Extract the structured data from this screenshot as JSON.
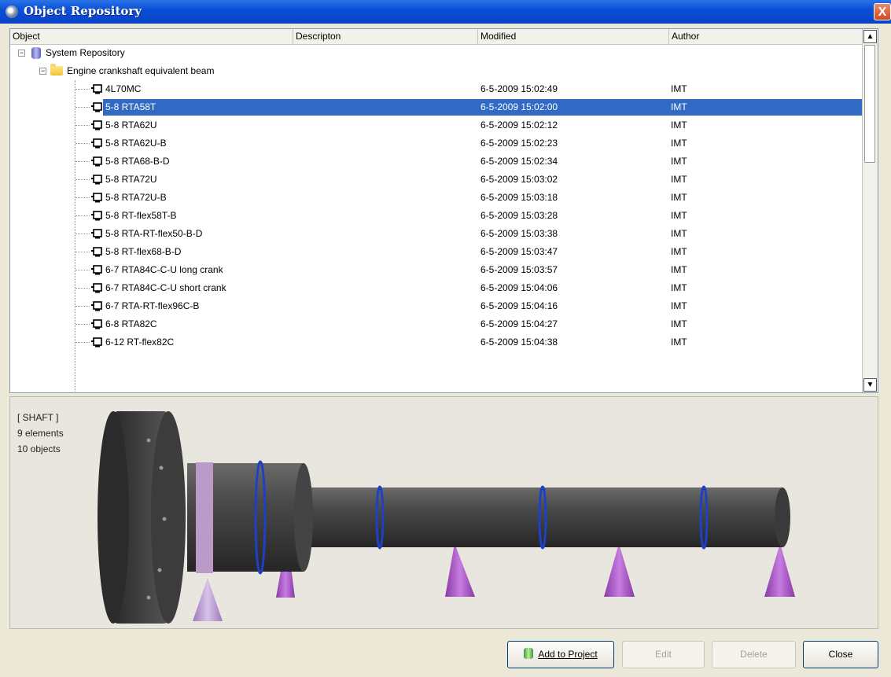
{
  "window": {
    "title": "Object Repository",
    "close_label": "X"
  },
  "columns": [
    "Object",
    "Descripton",
    "Modified",
    "Author"
  ],
  "tree": {
    "root": "System Repository",
    "folder": "Engine crankshaft equivalent beam",
    "items": [
      {
        "name": "4L70MC",
        "modified": "6-5-2009 15:02:49",
        "author": "IMT"
      },
      {
        "name": "5-8 RTA58T",
        "modified": "6-5-2009 15:02:00",
        "author": "IMT",
        "selected": true
      },
      {
        "name": "5-8 RTA62U",
        "modified": "6-5-2009 15:02:12",
        "author": "IMT"
      },
      {
        "name": "5-8 RTA62U-B",
        "modified": "6-5-2009 15:02:23",
        "author": "IMT"
      },
      {
        "name": "5-8 RTA68-B-D",
        "modified": "6-5-2009 15:02:34",
        "author": "IMT"
      },
      {
        "name": "5-8 RTA72U",
        "modified": "6-5-2009 15:03:02",
        "author": "IMT"
      },
      {
        "name": "5-8 RTA72U-B",
        "modified": "6-5-2009 15:03:18",
        "author": "IMT"
      },
      {
        "name": "5-8 RT-flex58T-B",
        "modified": "6-5-2009 15:03:28",
        "author": "IMT"
      },
      {
        "name": "5-8 RTA-RT-flex50-B-D",
        "modified": "6-5-2009 15:03:38",
        "author": "IMT"
      },
      {
        "name": "5-8 RT-flex68-B-D",
        "modified": "6-5-2009 15:03:47",
        "author": "IMT"
      },
      {
        "name": "6-7 RTA84C-C-U long crank",
        "modified": "6-5-2009 15:03:57",
        "author": "IMT"
      },
      {
        "name": "6-7 RTA84C-C-U short crank",
        "modified": "6-5-2009 15:04:06",
        "author": "IMT"
      },
      {
        "name": "6-7 RTA-RT-flex96C-B",
        "modified": "6-5-2009 15:04:16",
        "author": "IMT"
      },
      {
        "name": "6-8 RTA82C",
        "modified": "6-5-2009 15:04:27",
        "author": "IMT"
      },
      {
        "name": "6-12 RT-flex82C",
        "modified": "6-5-2009 15:04:38",
        "author": "IMT"
      }
    ]
  },
  "preview": {
    "type": "[ SHAFT ]",
    "elements": "9 elements",
    "objects": "10 objects"
  },
  "buttons": {
    "add": "Add to Project",
    "edit": "Edit",
    "delete": "Delete",
    "close": "Close"
  },
  "colors": {
    "selection": "#316ac5",
    "shaft": "#3d3d3d",
    "support": "#a450c8"
  }
}
